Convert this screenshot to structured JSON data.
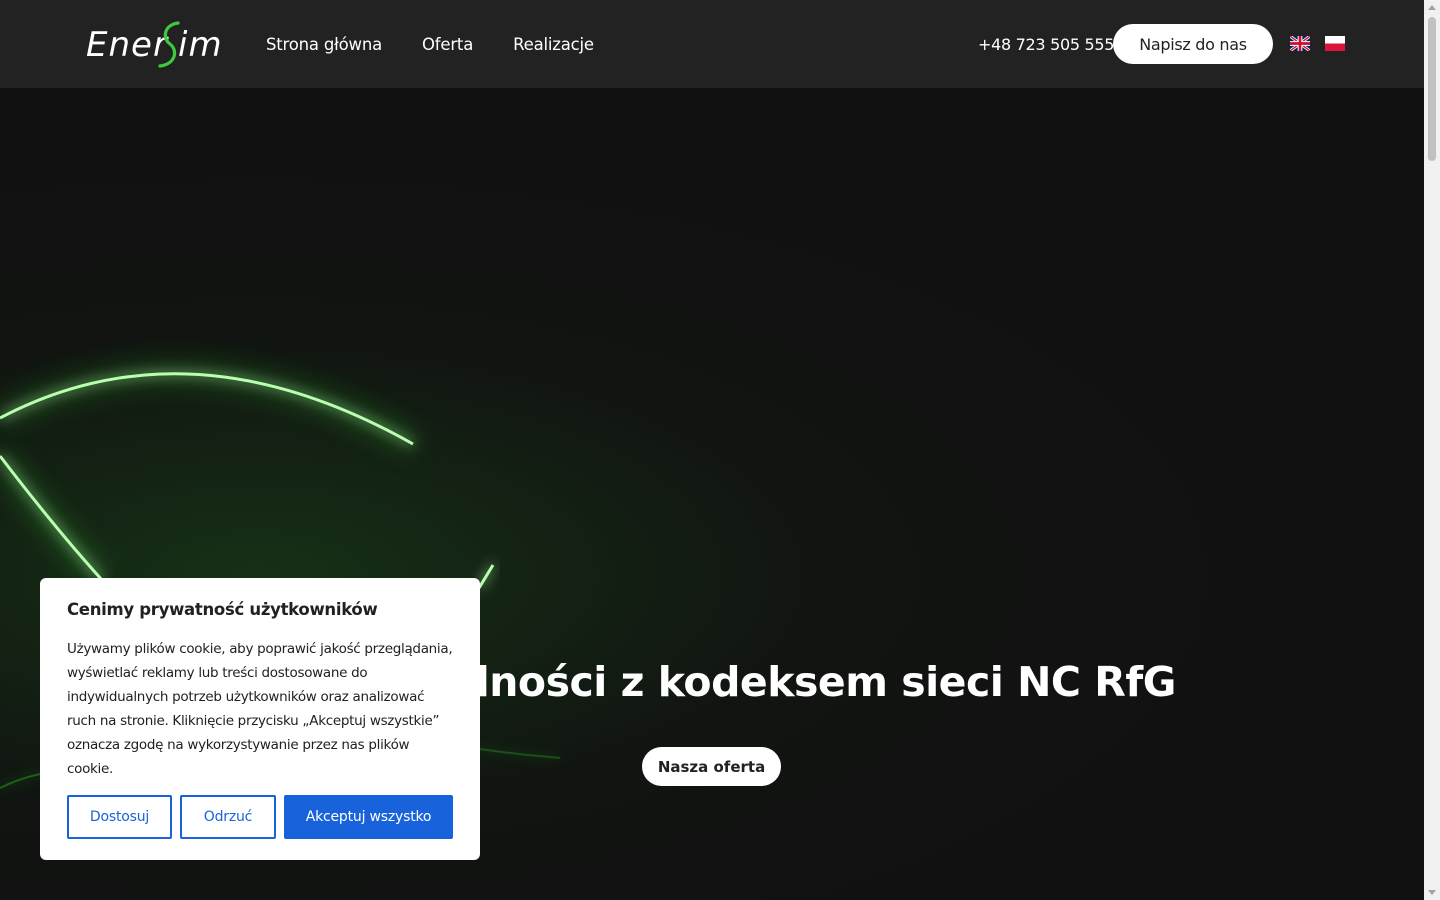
{
  "header": {
    "logo_text": "EnerSim",
    "nav": [
      {
        "label": "Strona główna"
      },
      {
        "label": "Oferta"
      },
      {
        "label": "Realizacje"
      }
    ],
    "phone": "+48 723 505 555",
    "contact_button": "Napisz do nas",
    "languages": [
      "en",
      "pl"
    ]
  },
  "hero": {
    "title": "Testy zgodności z kodeksem sieci NC RfG",
    "button": "Nasza oferta",
    "accent_color": "#3df53d"
  },
  "cookie": {
    "title": "Cenimy prywatność użytkowników",
    "text": "Używamy plików cookie, aby poprawić jakość przeglądania, wyświetlać reklamy lub treści dostosowane do indywidualnych potrzeb użytkowników oraz analizować ruch na stronie. Kliknięcie przycisku „Akceptuj wszystkie” oznacza zgodę na wykorzystywanie przez nas plików cookie.",
    "buttons": {
      "customize": "Dostosuj",
      "reject": "Odrzuć",
      "accept": "Akceptuj wszystko"
    },
    "button_color": "#1863dc"
  }
}
